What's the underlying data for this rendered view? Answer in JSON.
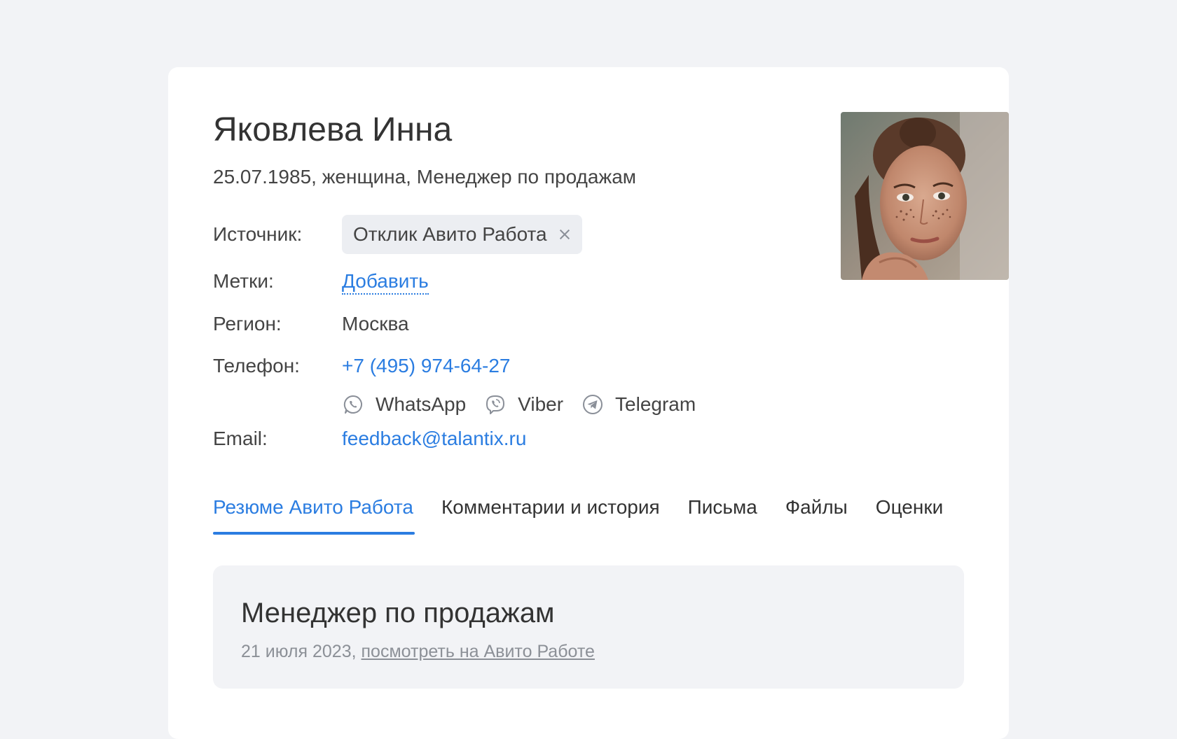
{
  "candidate": {
    "name": "Яковлева Инна",
    "summary": "25.07.1985, женщина, Менеджер по продажам"
  },
  "fields": {
    "source_label": "Источник:",
    "source_value": "Отклик Авито Работа",
    "tags_label": "Метки:",
    "tags_add": "Добавить",
    "region_label": "Регион:",
    "region_value": "Москва",
    "phone_label": "Телефон:",
    "phone_value": "+7 (495) 974-64-27",
    "email_label": "Email:",
    "email_value": "feedback@talantix.ru"
  },
  "messengers": [
    {
      "label": "WhatsApp",
      "icon": "whatsapp-icon"
    },
    {
      "label": "Viber",
      "icon": "viber-icon"
    },
    {
      "label": "Telegram",
      "icon": "telegram-icon"
    }
  ],
  "tabs": [
    {
      "label": "Резюме Авито Работа",
      "active": true
    },
    {
      "label": "Комментарии и история",
      "active": false
    },
    {
      "label": "Письма",
      "active": false
    },
    {
      "label": "Файлы",
      "active": false
    },
    {
      "label": "Оценки",
      "active": false
    }
  ],
  "resume": {
    "title": "Менеджер по продажам",
    "date": "21 июля 2023,",
    "link": "посмотреть на Авито Работе"
  },
  "colors": {
    "accent": "#2b7de1",
    "background": "#f2f3f6",
    "card": "#ffffff"
  }
}
